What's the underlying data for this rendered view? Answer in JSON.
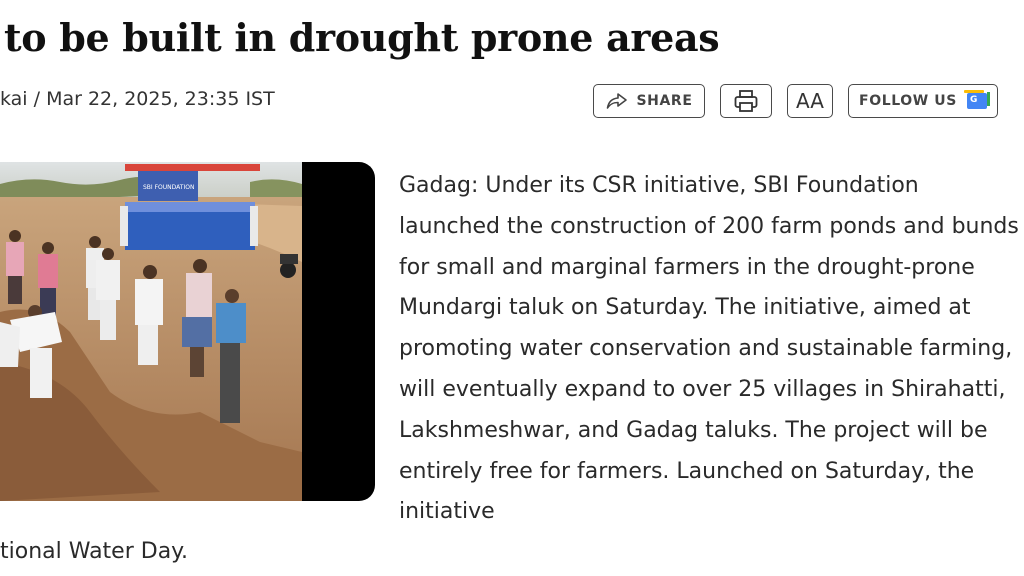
{
  "article": {
    "headline": "to be built in drought prone areas",
    "byline": "kai / Mar 22, 2025, 23:35 IST",
    "body": "Gadag: Under its CSR initiative, SBI Foundation launched the construction of 200 farm ponds and bunds for small and marginal farmers in the drought-prone Mundargi taluk on Saturday. The initiative, aimed at promoting water conservation and sustainable farming, will eventually expand to over 25 villages in Shirahatti, Lakshmeshwar, and Gadag taluks. The project will be entirely free for farmers. Launched on Saturday, the initiative",
    "tail": "tional Water Day."
  },
  "toolbar": {
    "share_label": "SHARE",
    "font_size_label": "AA",
    "follow_label": "FOLLOW US",
    "icons": [
      "share-icon",
      "print-icon",
      "google-news-icon"
    ]
  },
  "photo": {
    "banner_text": "SBI FOUNDATION"
  }
}
